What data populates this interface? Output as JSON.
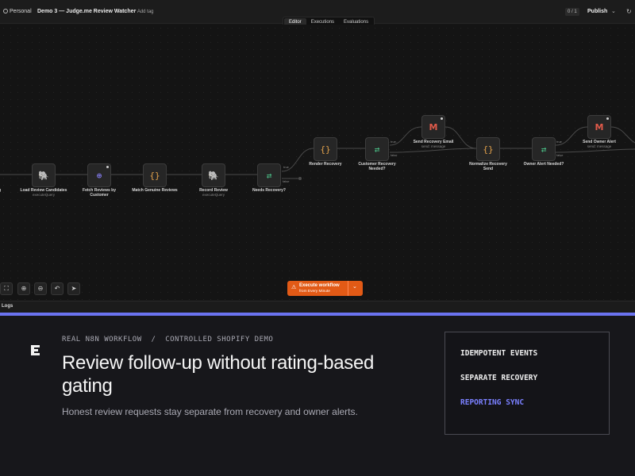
{
  "topbar": {
    "workspace": "Personal",
    "workflow_title": "Demo 3 — Judge.me Review Watcher",
    "add_tag": "+ Add tag",
    "counter": "0 / 1",
    "publish": "Publish",
    "caret": "⌄",
    "history_icon": "history-icon"
  },
  "tabs": [
    {
      "label": "Editor",
      "active": true
    },
    {
      "label": "Executions",
      "active": false
    },
    {
      "label": "Evaluations",
      "active": false
    }
  ],
  "nodes": {
    "load": {
      "label": "Load Review Candidates",
      "sub": "executeQuery",
      "icon": "postgres-icon"
    },
    "fetch": {
      "label": "Fetch Reviews by Customer",
      "icon": "globe-icon"
    },
    "match": {
      "label": "Match Genuine Reviews",
      "icon": "code-icon"
    },
    "record": {
      "label": "Record Review",
      "sub": "executeQuery",
      "icon": "postgres-icon"
    },
    "needs": {
      "label": "Needs Recovery?",
      "icon": "if-icon"
    },
    "render": {
      "label": "Render Recovery",
      "icon": "code-icon"
    },
    "customer": {
      "label": "Customer Recovery Needed?",
      "icon": "if-icon"
    },
    "sendrec": {
      "label": "Send Recovery Email",
      "sub": "send: message",
      "icon": "gmail-icon"
    },
    "normalize": {
      "label": "Normalize Recovery Send",
      "icon": "code-icon"
    },
    "owner": {
      "label": "Owner Alert Needed?",
      "icon": "if-icon"
    },
    "sendowner": {
      "label": "Send Owner Alert",
      "sub": "send: message",
      "icon": "gmail-icon"
    }
  },
  "edge_labels": {
    "true": "true",
    "false": "false"
  },
  "left_cut_label": "g",
  "controls": [
    "fit-view-icon",
    "zoom-in-icon",
    "zoom-out-icon",
    "undo-icon",
    "pointer-icon"
  ],
  "execute": {
    "label": "Execute workflow",
    "sub": "from Every Minute"
  },
  "logs": "Logs",
  "colors": {
    "accent": "#6b73f0",
    "execute": "#e25a16",
    "highlight": "#7a80ff"
  },
  "banner": {
    "eyebrow": "REAL N8N WORKFLOW  /  CONTROLLED SHOPIFY DEMO",
    "headline": "Review follow-up without rating-based gating",
    "subtext": "Honest review requests stay separate from recovery and owner alerts.",
    "items": [
      {
        "label": "IDEMPOTENT EVENTS",
        "highlight": false
      },
      {
        "label": "SEPARATE RECOVERY",
        "highlight": false
      },
      {
        "label": "REPORTING SYNC",
        "highlight": true
      }
    ]
  }
}
